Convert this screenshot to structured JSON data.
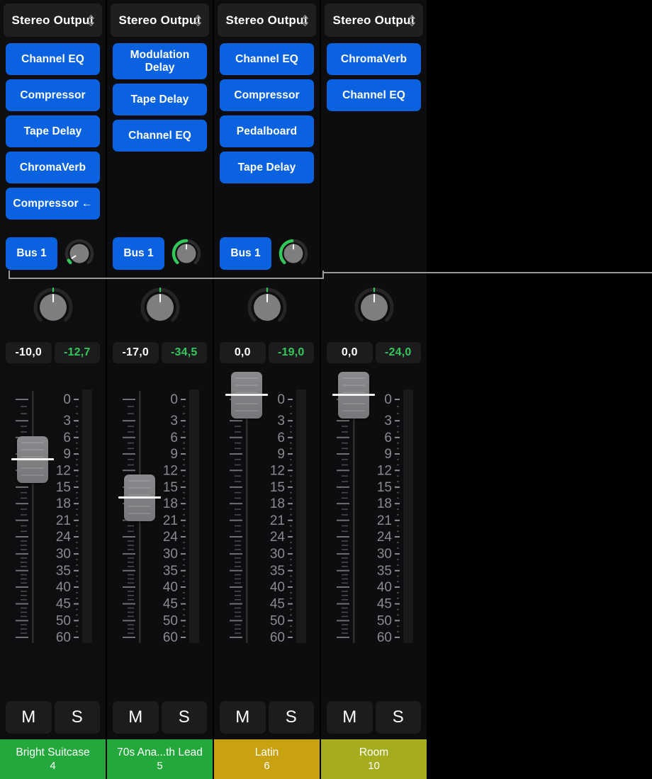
{
  "app": "mixer",
  "colors": {
    "slot_blue": "#0a62e0",
    "peak_green": "#32c759",
    "knob_arc_green": "#32c759",
    "name_green": "#23a83c",
    "name_gold": "#c9a211",
    "name_olive": "#a5ac1e",
    "panel_bg": "#0d0d0f",
    "control_bg": "#1c1c1e"
  },
  "fader_scale": {
    "labels": [
      "0",
      "3",
      "6",
      "9",
      "12",
      "15",
      "18",
      "21",
      "24",
      "30",
      "35",
      "40",
      "45",
      "50",
      "60"
    ],
    "unit": "dB"
  },
  "icons": {
    "output_chevron": "chevron-up-down-icon",
    "sidechain_arrow": "←"
  },
  "channels": [
    {
      "index": 1,
      "output": {
        "label": "Stereo Output",
        "chevron": "chevron-up-down-icon"
      },
      "plugins": [
        "Channel EQ",
        "Compressor",
        "Tape Delay",
        "ChromaVerb",
        "Compressor ←"
      ],
      "send": {
        "label": "Bus 1",
        "has_send": true,
        "knob_value_deg": -122,
        "arc_start_deg": -135,
        "arc_end_deg": -122
      },
      "pan": {
        "value_deg": 0
      },
      "gain": "-10,0",
      "peak": "-12,7",
      "fader_db": -10.0,
      "mute_label": "M",
      "solo_label": "S",
      "name": "Bright Suitcase",
      "number": "4",
      "name_color": "#23a83c",
      "selected": true
    },
    {
      "index": 2,
      "output": {
        "label": "Stereo Output",
        "chevron": "chevron-up-down-icon"
      },
      "plugins": [
        "Modulation Delay",
        "Tape Delay",
        "Channel EQ"
      ],
      "send": {
        "label": "Bus 1",
        "has_send": true,
        "knob_value_deg": 0,
        "arc_start_deg": -135,
        "arc_end_deg": 0
      },
      "pan": {
        "value_deg": 0
      },
      "gain": "-17,0",
      "peak": "-34,5",
      "fader_db": -17.0,
      "mute_label": "M",
      "solo_label": "S",
      "name": "70s Ana...th Lead",
      "number": "5",
      "name_color": "#23a83c",
      "selected": true
    },
    {
      "index": 3,
      "output": {
        "label": "Stereo Output",
        "chevron": "chevron-up-down-icon"
      },
      "plugins": [
        "Channel EQ",
        "Compressor",
        "Pedalboard",
        "Tape Delay"
      ],
      "send": {
        "label": "Bus 1",
        "has_send": true,
        "knob_value_deg": 0,
        "arc_start_deg": -135,
        "arc_end_deg": -6
      },
      "pan": {
        "value_deg": 0
      },
      "gain": "0,0",
      "peak": "-19,0",
      "fader_db": 0.0,
      "mute_label": "M",
      "solo_label": "S",
      "name": "Latin",
      "number": "6",
      "name_color": "#c9a211",
      "selected": true
    },
    {
      "index": 4,
      "output": {
        "label": "Stereo Output",
        "chevron": "chevron-up-down-icon"
      },
      "plugins": [
        "ChromaVerb",
        "Channel EQ"
      ],
      "send": {
        "label": "",
        "has_send": false,
        "knob_value_deg": 0,
        "arc_start_deg": -135,
        "arc_end_deg": -135
      },
      "pan": {
        "value_deg": 0
      },
      "gain": "0,0",
      "peak": "-24,0",
      "fader_db": 0.0,
      "mute_label": "M",
      "solo_label": "S",
      "name": "Room",
      "number": "10",
      "name_color": "#a5ac1e",
      "selected": false
    }
  ]
}
